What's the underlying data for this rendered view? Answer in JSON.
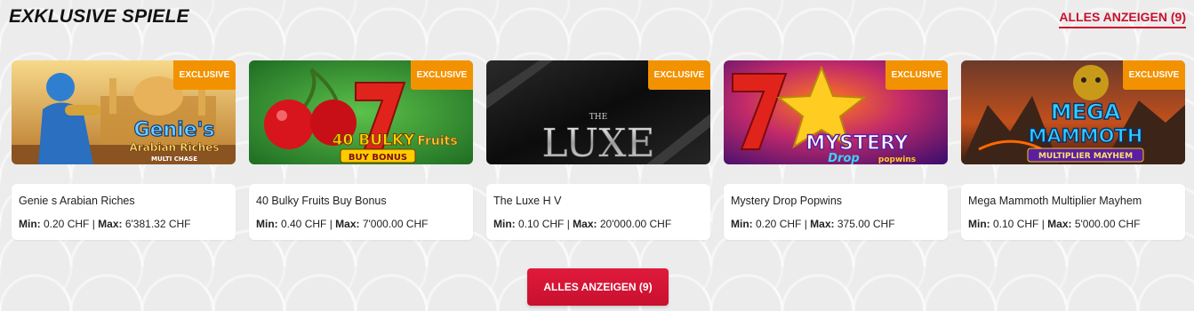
{
  "section": {
    "title": "EXKLUSIVE SPIELE",
    "view_all_top": "ALLES ANZEIGEN (9)",
    "view_all_bottom": "ALLES ANZEIGEN (9)"
  },
  "labels": {
    "min": "Min:",
    "max": "Max:",
    "separator": " | "
  },
  "games": [
    {
      "badge": "EXCLUSIVE",
      "name": "Genie s Arabian Riches",
      "min": "0.20 CHF",
      "max": "6'381.32 CHF",
      "art_lines": [
        "Genie's",
        "Arabian Riches",
        "MULTI CHASE"
      ],
      "colors": {
        "primary": "#d9a441",
        "accent": "#3aa0e6"
      }
    },
    {
      "badge": "EXCLUSIVE",
      "name": "40 Bulky Fruits Buy Bonus",
      "min": "0.40 CHF",
      "max": "7'000.00 CHF",
      "art_lines": [
        "40 BULKY",
        "Fruits",
        "BUY BONUS"
      ],
      "colors": {
        "primary": "#2e8b2e",
        "accent": "#e0241c"
      }
    },
    {
      "badge": "EXCLUSIVE",
      "name": "The Luxe H V",
      "min": "0.10 CHF",
      "max": "20'000.00 CHF",
      "art_lines": [
        "THE",
        "LUXE"
      ],
      "colors": {
        "primary": "#151515",
        "accent": "#d8d8d8"
      }
    },
    {
      "badge": "EXCLUSIVE",
      "name": "Mystery Drop Popwins",
      "min": "0.20 CHF",
      "max": "375.00 CHF",
      "art_lines": [
        "MYSTERY",
        "Drop",
        "popwins"
      ],
      "colors": {
        "primary": "#7a1fa2",
        "accent": "#ffcc22"
      }
    },
    {
      "badge": "EXCLUSIVE",
      "name": "Mega Mammoth Multiplier Mayhem",
      "min": "0.10 CHF",
      "max": "5'000.00 CHF",
      "art_lines": [
        "MEGA",
        "MAMMOTH",
        "MULTIPLIER MAYHEM"
      ],
      "colors": {
        "primary": "#b8441a",
        "accent": "#f5c518"
      }
    }
  ]
}
